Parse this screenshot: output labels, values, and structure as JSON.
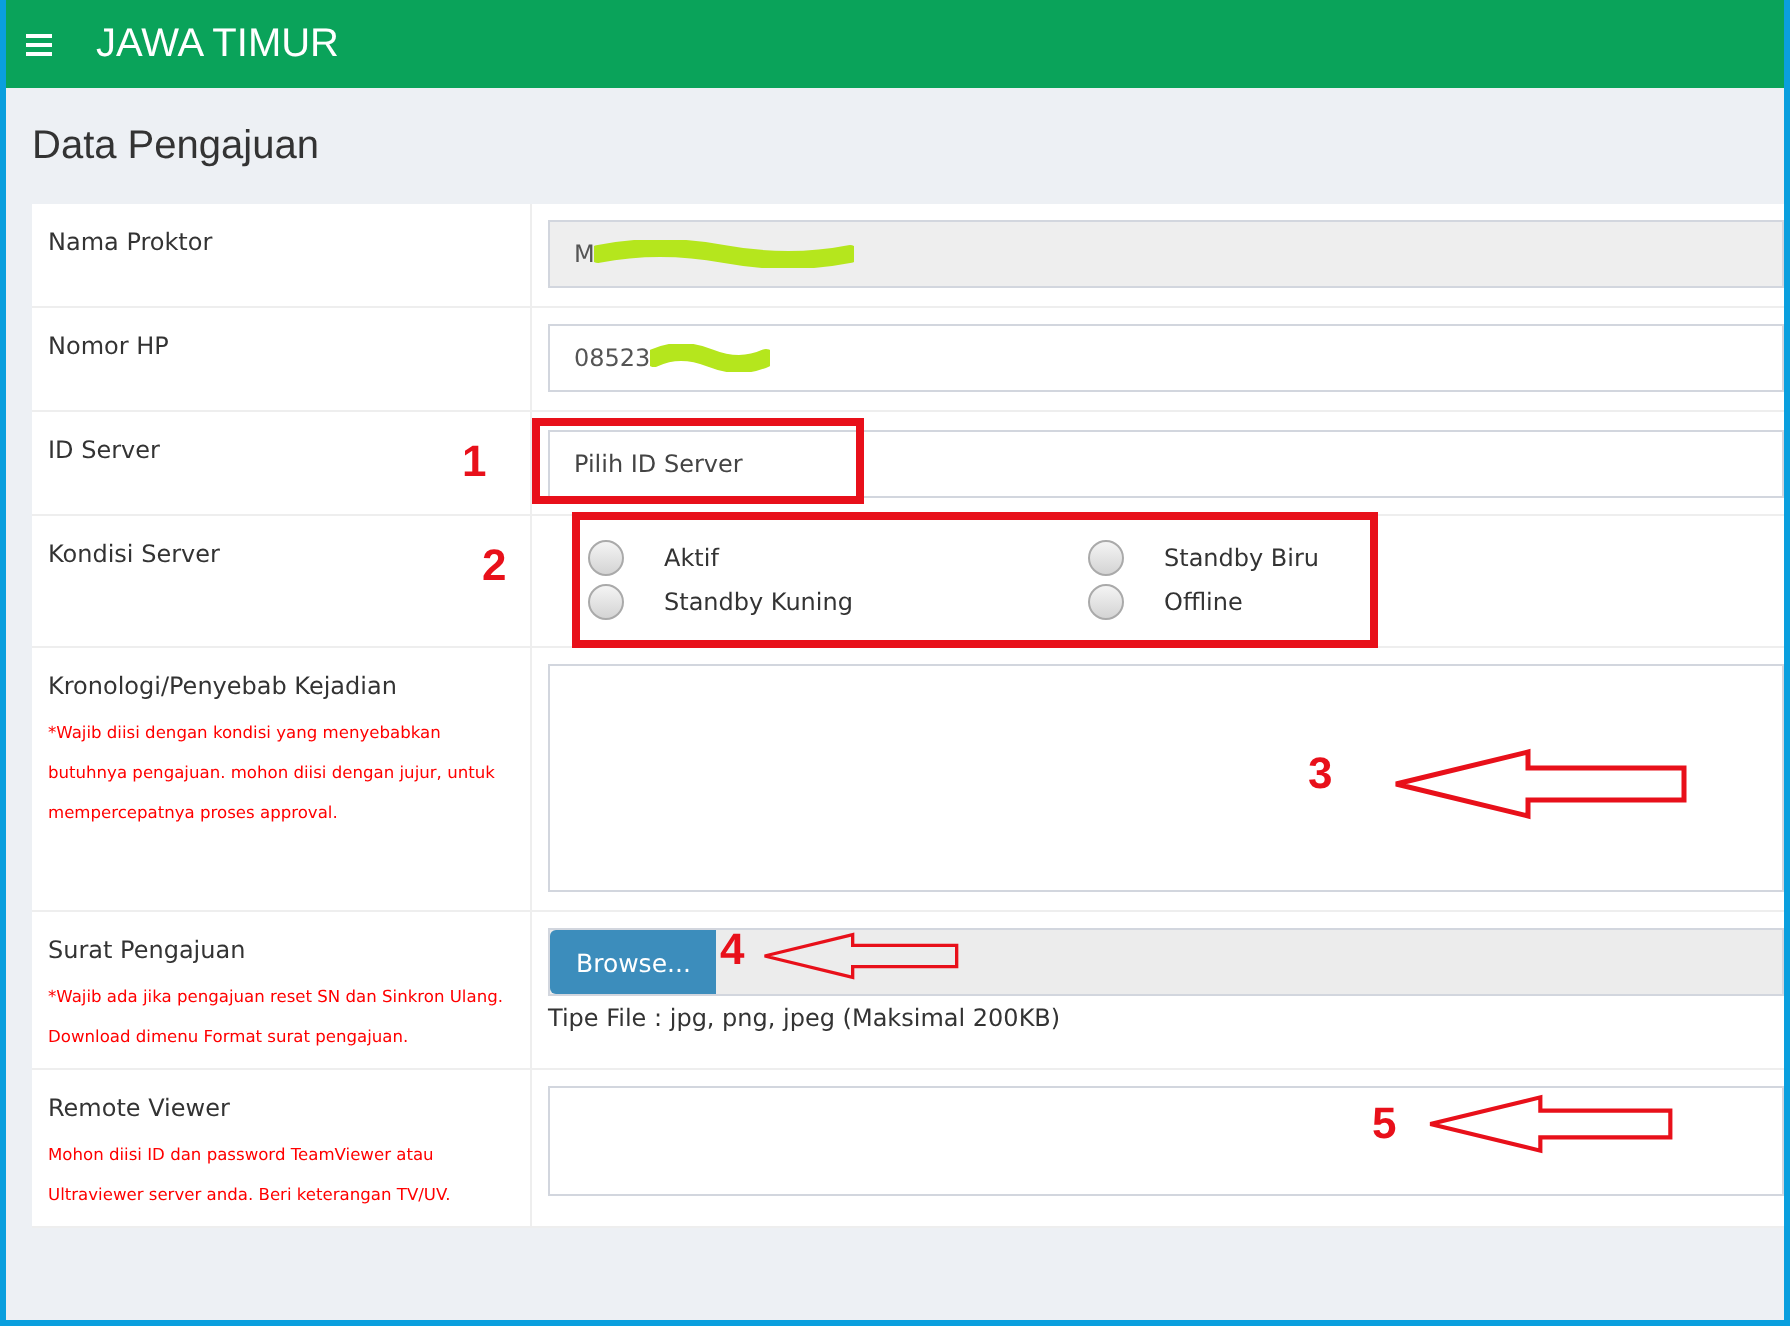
{
  "header": {
    "title": "JAWA TIMUR"
  },
  "page_title": "Data Pengajuan",
  "form_rows": [
    {
      "kind": "text",
      "label": "Nama Proktor",
      "value": "M",
      "redacted": true,
      "disabled": true
    },
    {
      "kind": "text",
      "label": "Nomor HP",
      "value": "08523",
      "redacted": true,
      "disabled": false
    },
    {
      "kind": "select",
      "label": "ID Server",
      "value": "Pilih ID Server",
      "annotation": {
        "number": "1",
        "kind": "box"
      }
    },
    {
      "kind": "radio",
      "label": "Kondisi Server",
      "annotation": {
        "number": "2",
        "kind": "box"
      },
      "options": [
        {
          "label": "Aktif",
          "selected": false
        },
        {
          "label": "Standby Biru",
          "selected": false
        },
        {
          "label": "Standby Kuning",
          "selected": false
        },
        {
          "label": "Offline",
          "selected": false
        }
      ]
    },
    {
      "kind": "textarea",
      "label": "Kronologi/Penyebab Kejadian",
      "note": "*Wajib diisi dengan kondisi yang menyebabkan butuhnya pengajuan. mohon diisi dengan jujur, untuk mempercepatnya proses approval.",
      "annotation": {
        "number": "3",
        "kind": "arrow"
      }
    },
    {
      "kind": "file",
      "label": "Surat Pengajuan",
      "note": "*Wajib ada jika pengajuan reset SN dan Sinkron Ulang. Download dimenu Format surat pengajuan.",
      "button": "Browse...",
      "hint": "Tipe File : jpg, png, jpeg (Maksimal 200KB)",
      "annotation": {
        "number": "4",
        "kind": "arrow"
      }
    },
    {
      "kind": "short_textarea",
      "label": "Remote Viewer",
      "note": "Mohon diisi ID dan password TeamViewer atau Ultraviewer server anda. Beri keterangan TV/UV.",
      "annotation": {
        "number": "5",
        "kind": "arrow"
      }
    }
  ]
}
